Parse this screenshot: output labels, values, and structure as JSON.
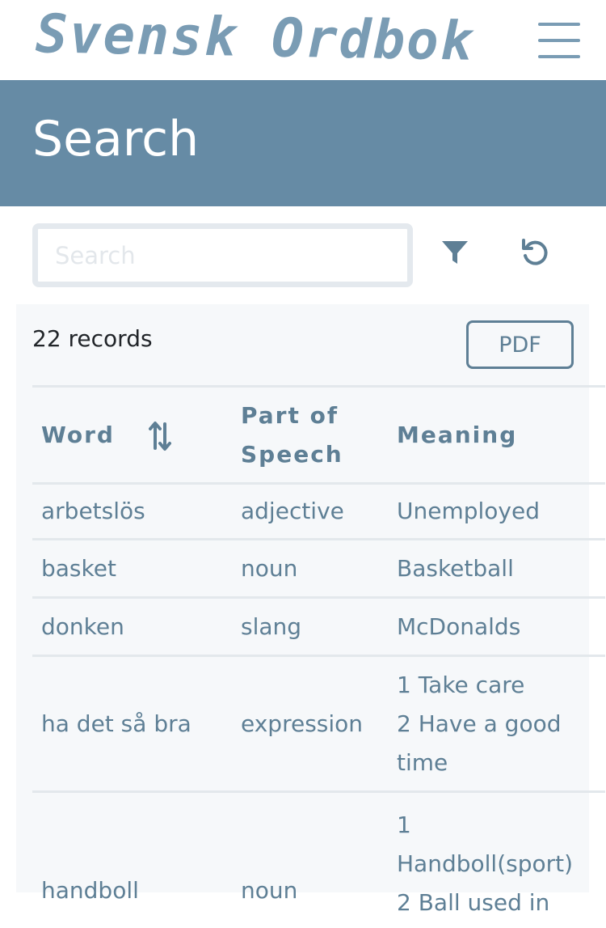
{
  "app": {
    "logo_text": "Svensk Ordbok"
  },
  "header": {
    "title": "Search"
  },
  "search": {
    "placeholder": "Search",
    "value": ""
  },
  "toolbar": {
    "filter_icon": "filter-icon",
    "reset_icon": "reset-icon"
  },
  "results": {
    "count_label": "22 records",
    "pdf_label": "PDF",
    "columns": {
      "word": "Word",
      "pos_line1": "Part of",
      "pos_line2": "Speech",
      "meaning": "Meaning"
    },
    "rows": [
      {
        "word": "arbetslös",
        "pos": "adjective",
        "meaning": [
          "Unemployed"
        ]
      },
      {
        "word": "basket",
        "pos": "noun",
        "meaning": [
          "Basketball"
        ]
      },
      {
        "word": "donken",
        "pos": "slang",
        "meaning": [
          "McDonalds"
        ]
      },
      {
        "word": "ha det så bra",
        "pos": "expression",
        "meaning": [
          "1 Take care",
          "2 Have a good",
          "time"
        ]
      },
      {
        "word": "handboll",
        "pos": "noun",
        "meaning": [
          "1",
          "Handboll(sport)",
          "2 Ball used in"
        ]
      }
    ]
  },
  "colors": {
    "brand": "#668ba5",
    "logo": "#7a9cb4",
    "text_accent": "#5e7f95",
    "panel_bg": "#f6f8fa"
  }
}
